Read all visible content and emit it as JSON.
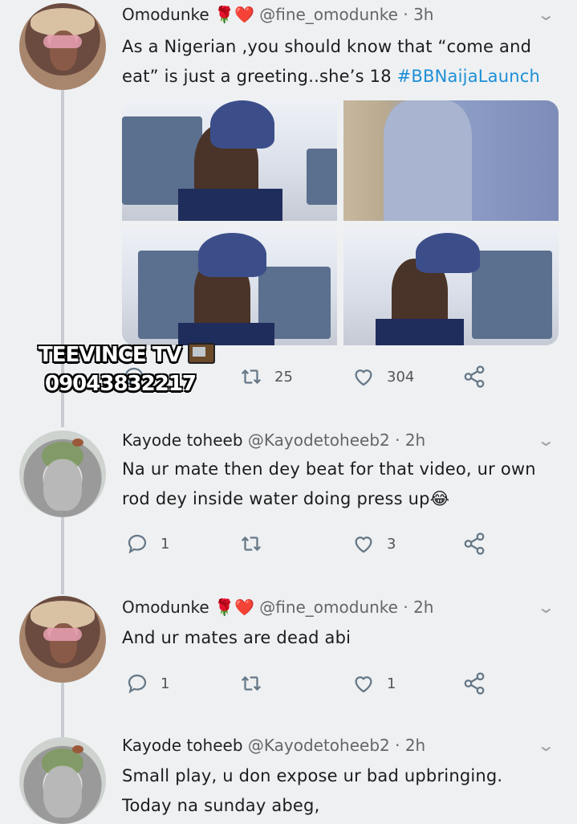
{
  "watermark": {
    "line1": "TEEVINCE TV",
    "line2": "09043832217"
  },
  "tweets": [
    {
      "name": "Omodunke",
      "emoji": "🌹❤️",
      "handle": "@fine_omodunke",
      "time": "3h",
      "text_before": "As a Nigerian ,you should know that “come and eat” is just a greeting..she’s 18 ",
      "hashtag": "#BBNaijaLaunch",
      "replies": "",
      "retweets": "25",
      "likes": "304"
    },
    {
      "name": "Kayode toheeb",
      "handle": "@Kayodetoheeb2",
      "time": "2h",
      "text": "Na ur mate then dey beat for that video, ur own rod dey inside water doing press up😂",
      "replies": "1",
      "retweets": "",
      "likes": "3"
    },
    {
      "name": "Omodunke",
      "emoji": "🌹❤️",
      "handle": "@fine_omodunke",
      "time": "2h",
      "text": "And ur mates are dead abi",
      "replies": "1",
      "retweets": "",
      "likes": "1"
    },
    {
      "name": "Kayode toheeb",
      "handle": "@Kayodetoheeb2",
      "time": "2h",
      "text": "Small play, u don expose ur bad upbringing. Today na sunday abeg,"
    }
  ],
  "icons": {
    "reply": "reply-icon",
    "retweet": "retweet-icon",
    "like": "heart-icon",
    "share": "share-icon",
    "more": "chevron-down-icon"
  },
  "colors": {
    "hashtag": "#1d8fd6",
    "action": "#657786",
    "background": "#eef0f2"
  }
}
